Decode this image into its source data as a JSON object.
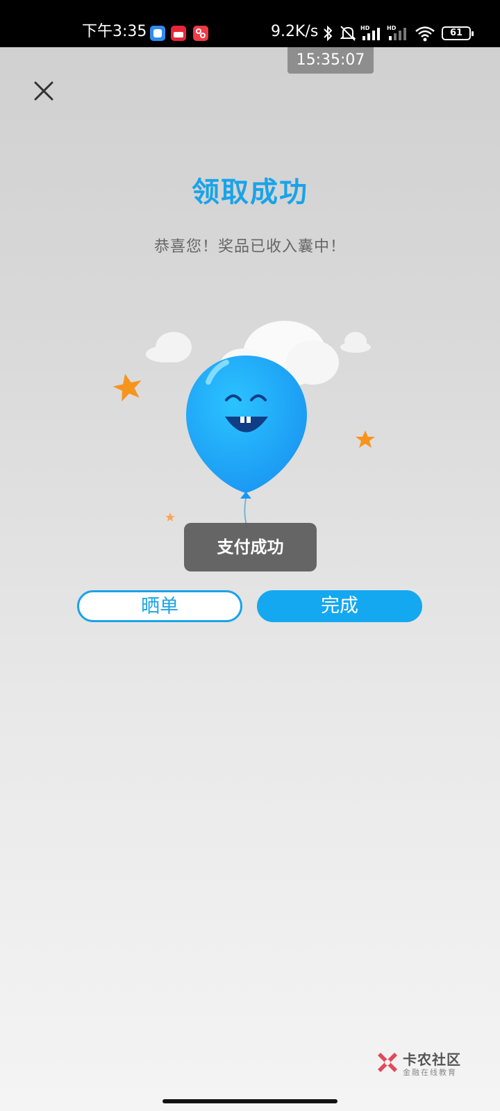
{
  "status_bar": {
    "time": "下午3:35",
    "network_speed": "9.2K/s",
    "battery_level": "61",
    "icons": [
      "app-icon-blue",
      "app-icon-red",
      "app-icon-red-2",
      "bluetooth-icon",
      "mute-icon",
      "signal-hd-icon",
      "signal-hd-icon-2",
      "wifi-icon",
      "battery-icon"
    ]
  },
  "time_overlay": "15:35:07",
  "page": {
    "title": "领取成功",
    "subtitle": "恭喜您！奖品已收入囊中！"
  },
  "toast": {
    "text": "支付成功"
  },
  "buttons": {
    "share_label": "晒单",
    "done_label": "完成"
  },
  "watermark": {
    "name": "卡农社区",
    "tagline": "金融在线教育"
  },
  "colors": {
    "accent": "#1aa3e8",
    "balloon": "#1eaaf5",
    "star": "#f7941d",
    "toast_bg": "#5a5a5a"
  }
}
